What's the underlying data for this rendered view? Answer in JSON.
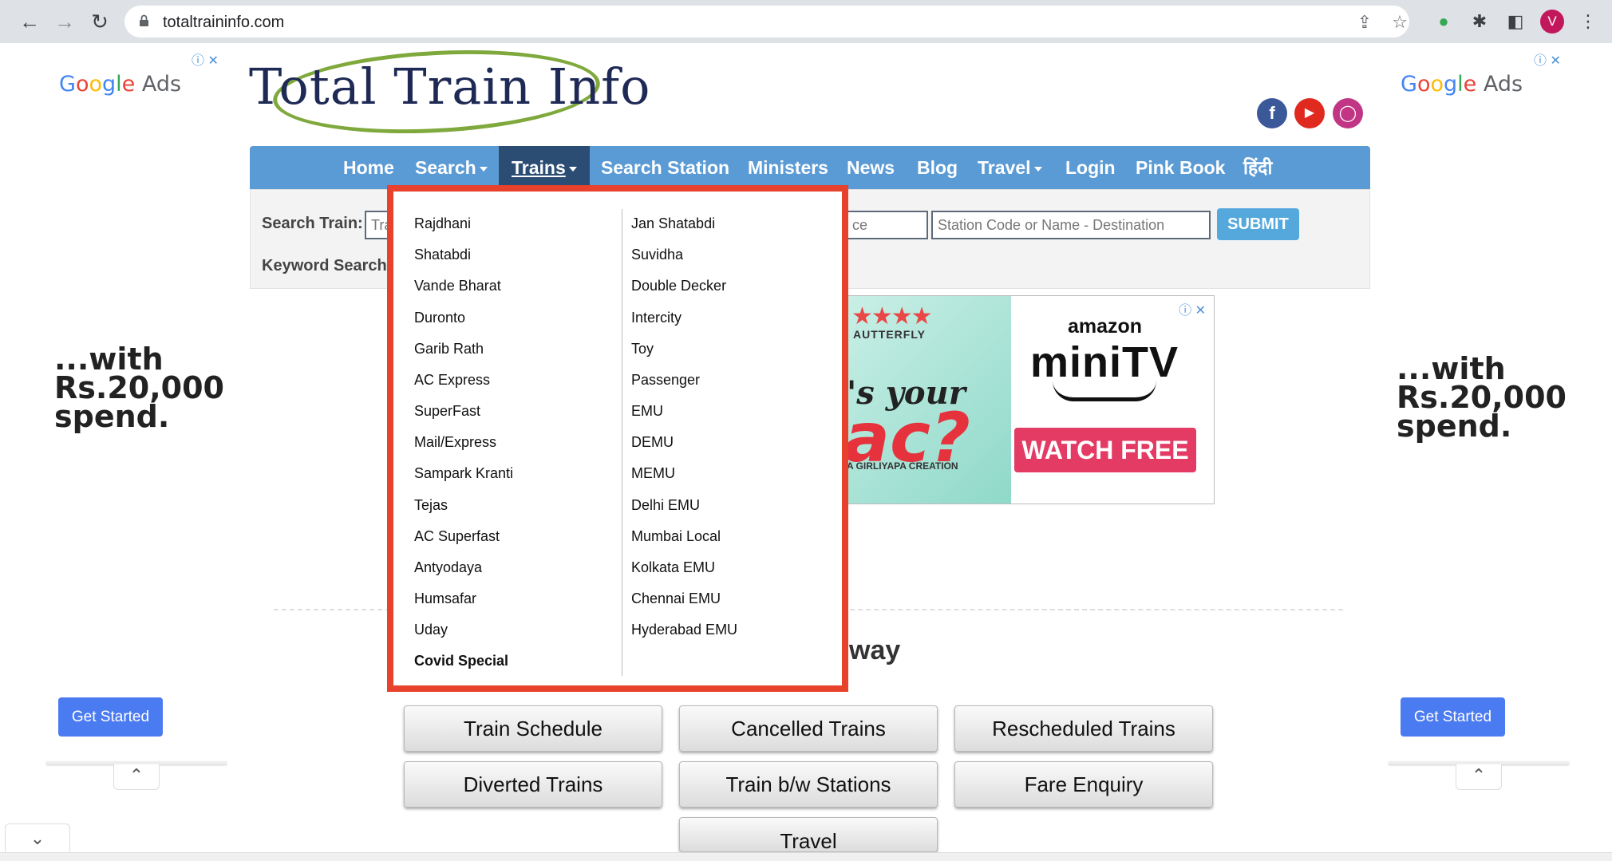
{
  "browser": {
    "url": "totaltraininfo.com",
    "avatar_letter": "V"
  },
  "site": {
    "logo_text": "Total Train Info",
    "social": [
      "facebook",
      "youtube",
      "instagram"
    ]
  },
  "side_ads": {
    "left": {
      "brand": "Google Ads",
      "promo_line1": "...with",
      "promo_line2": "Rs.20,000",
      "promo_line3": "spend.",
      "button": "Get Started"
    },
    "right": {
      "brand": "Google Ads",
      "promo_line1": "...with",
      "promo_line2": "Rs.20,000",
      "promo_line3": "spend.",
      "button": "Get Started"
    }
  },
  "nav": {
    "items": [
      {
        "label": "Home"
      },
      {
        "label": "Search",
        "has_caret": true
      },
      {
        "label": "Trains",
        "has_caret": true,
        "active": true
      },
      {
        "label": "Search Station"
      },
      {
        "label": "Ministers"
      },
      {
        "label": "News"
      },
      {
        "label": "Blog"
      },
      {
        "label": "Travel",
        "has_caret": true
      },
      {
        "label": "Login"
      },
      {
        "label": "Pink Book"
      },
      {
        "label": "हिंदी"
      }
    ]
  },
  "search": {
    "train_label": "Search Train:",
    "train_partial": "Tra",
    "keyword_label": "Keyword Search",
    "source_partial": "ce",
    "destination_placeholder": "Station Code or Name - Destination",
    "submit": "SUBMIT"
  },
  "banner": {
    "brand_small": "AUTTERFLY",
    "text1": "'s your",
    "text2": "ac?",
    "creation": "A GIRLIYAPA CREATION",
    "amazon": "amazon",
    "minitv": "miniTV",
    "cta": "WATCH FREE"
  },
  "heading_partial": "way",
  "dropdown": {
    "col1": [
      "Rajdhani",
      "Shatabdi",
      "Vande Bharat",
      "Duronto",
      "Garib Rath",
      "AC Express",
      "SuperFast",
      "Mail/Express",
      "Sampark Kranti",
      "Tejas",
      "AC Superfast",
      "Antyodaya",
      "Humsafar",
      "Uday",
      "Covid Special"
    ],
    "col2": [
      "Jan Shatabdi",
      "Suvidha",
      "Double Decker",
      "Intercity",
      "Toy",
      "Passenger",
      "EMU",
      "DEMU",
      "MEMU",
      "Delhi EMU",
      "Mumbai Local",
      "Kolkata EMU",
      "Chennai EMU",
      "Hyderabad EMU"
    ]
  },
  "buttons": {
    "row1": [
      "Train Schedule",
      "Cancelled Trains",
      "Rescheduled Trains"
    ],
    "row2": [
      "Diverted Trains",
      "Train b/w Stations",
      "Fare Enquiry"
    ],
    "row3": [
      "Travel"
    ]
  },
  "colors": {
    "nav_bg": "#5b9bd5",
    "nav_active": "#2c4d73",
    "highlight_border": "#e8412c",
    "submit_bg": "#55a8dc",
    "getstarted_bg": "#4b7bf0",
    "watch_free_bg": "#e33b64"
  }
}
